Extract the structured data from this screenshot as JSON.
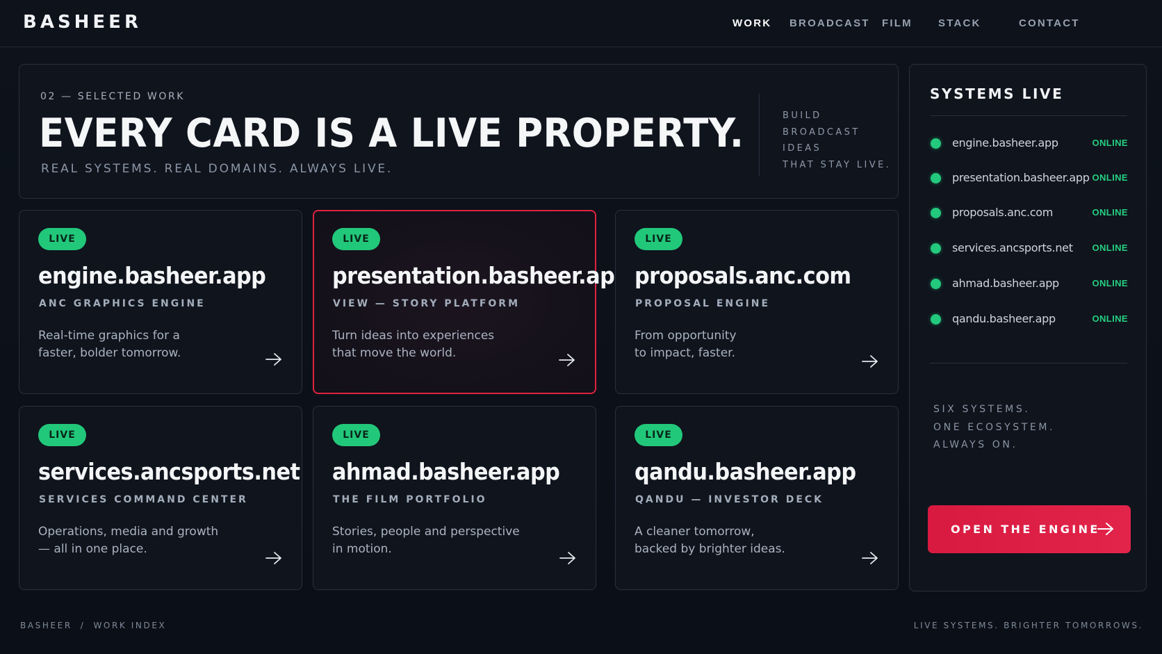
{
  "brand": {
    "name": "BASHEER"
  },
  "nav": {
    "items": [
      {
        "label": "WORK",
        "active": true
      },
      {
        "label": "BROADCAST",
        "active": false
      },
      {
        "label": "FILM",
        "active": false
      },
      {
        "label": "STACK",
        "active": false
      },
      {
        "label": "CONTACT",
        "active": false
      }
    ]
  },
  "hero": {
    "eyebrow": "02 — SELECTED WORK",
    "title": "EVERY CARD IS A LIVE PROPERTY.",
    "subtitle": "REAL SYSTEMS. REAL DOMAINS. ALWAYS LIVE.",
    "tagline": [
      "BUILD",
      "BROADCAST",
      "IDEAS",
      "THAT STAY LIVE."
    ]
  },
  "cards": [
    {
      "badge": "LIVE",
      "domain": "engine.basheer.app",
      "role": "ANC GRAPHICS ENGINE",
      "desc": [
        "Real-time graphics for a",
        "faster, bolder tomorrow."
      ],
      "arrow_icon": "arrow-right-icon"
    },
    {
      "badge": "LIVE",
      "domain": "presentation.basheer.app",
      "role": "VIEW — STORY PLATFORM",
      "desc": [
        "Turn ideas into experiences",
        "that move the world."
      ],
      "arrow_icon": "arrow-right-icon",
      "highlighted": true
    },
    {
      "badge": "LIVE",
      "domain": "proposals.anc.com",
      "role": "PROPOSAL ENGINE",
      "desc": [
        "From opportunity",
        "to impact, faster."
      ],
      "arrow_icon": "arrow-right-icon"
    },
    {
      "badge": "LIVE",
      "domain": "services.ancsports.net",
      "role": "SERVICES COMMAND CENTER",
      "desc": [
        "Operations, media and growth",
        "— all in one place."
      ],
      "arrow_icon": "arrow-right-icon"
    },
    {
      "badge": "LIVE",
      "domain": "ahmad.basheer.app",
      "role": "THE FILM PORTFOLIO",
      "desc": [
        "Stories, people and perspective",
        "in motion."
      ],
      "arrow_icon": "arrow-right-icon"
    },
    {
      "badge": "LIVE",
      "domain": "qandu.basheer.app",
      "role": "QANDU — INVESTOR DECK",
      "desc": [
        "A cleaner tomorrow,",
        "backed by brighter ideas."
      ],
      "arrow_icon": "arrow-right-icon"
    }
  ],
  "sidebar": {
    "title": "SYSTEMS LIVE",
    "systems": [
      {
        "host": "engine.basheer.app",
        "status": "ONLINE"
      },
      {
        "host": "presentation.basheer.app",
        "status": "ONLINE"
      },
      {
        "host": "proposals.anc.com",
        "status": "ONLINE"
      },
      {
        "host": "services.ancsports.net",
        "status": "ONLINE"
      },
      {
        "host": "ahmad.basheer.app",
        "status": "ONLINE"
      },
      {
        "host": "qandu.basheer.app",
        "status": "ONLINE"
      }
    ],
    "note": [
      "SIX SYSTEMS.",
      "ONE ECOSYSTEM.",
      "ALWAYS ON."
    ],
    "cta_label": "OPEN THE ENGINE"
  },
  "footer": {
    "left": [
      "BASHEER",
      "/",
      "WORK INDEX"
    ],
    "right": "LIVE SYSTEMS. BRIGHTER TOMORROWS."
  },
  "colors": {
    "background": "#0c1119",
    "accent": "#e0223f",
    "live_green": "#22c87a",
    "text": "#f4f5f7"
  }
}
